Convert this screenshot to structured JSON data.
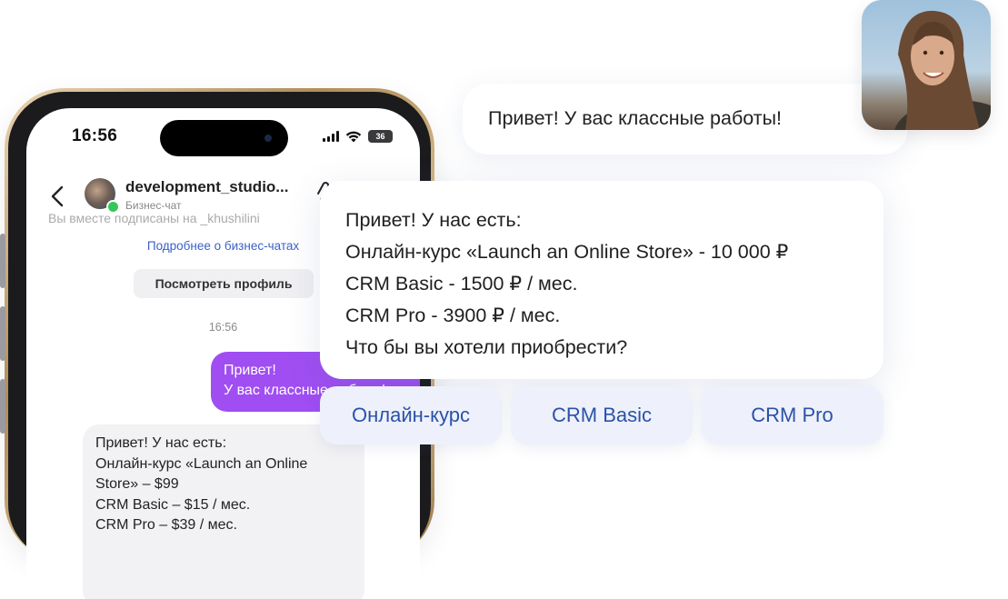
{
  "phone": {
    "status_time": "16:56",
    "battery": "36",
    "chat_name": "development_studio...",
    "chat_subtitle": "Бизнес-чат",
    "cut_off_line": "Вы вместе подписаны на _khushilini",
    "more_link": "Подробнее о бизнес-чатах",
    "profile_button": "Посмотреть профиль",
    "message_time": "16:56",
    "outgoing_lines": [
      "Привет!",
      "У вас классные работы!"
    ],
    "incoming_lines": [
      "Привет! У нас есть:",
      "Онлайн-курс «Launch an Online",
      "Store» – $99",
      "CRM Basic – $15 / мес.",
      "CRM Pro – $39 / мес."
    ]
  },
  "user_message": "Привет! У вас классные работы!",
  "bot_message": {
    "lines": [
      "Привет! У нас есть:",
      "Онлайн-курс «Launch an Online Store» - 10 000 ₽",
      "CRM Basic - 1500 ₽ / мес.",
      "CRM Pro - 3900 ₽ / мес.",
      "Что бы вы хотели приобрести?"
    ]
  },
  "options": [
    "Онлайн-курс",
    "CRM Basic",
    "CRM Pro"
  ],
  "colors": {
    "outgoing_bubble": "#a04ef2",
    "option_bg": "#eef1fb",
    "option_text": "#2a52a8",
    "link": "#3b5fc9",
    "online": "#34c759"
  },
  "icons": [
    "back-chevron-icon",
    "pin-icon",
    "signal-icon",
    "wifi-icon",
    "battery-icon"
  ]
}
